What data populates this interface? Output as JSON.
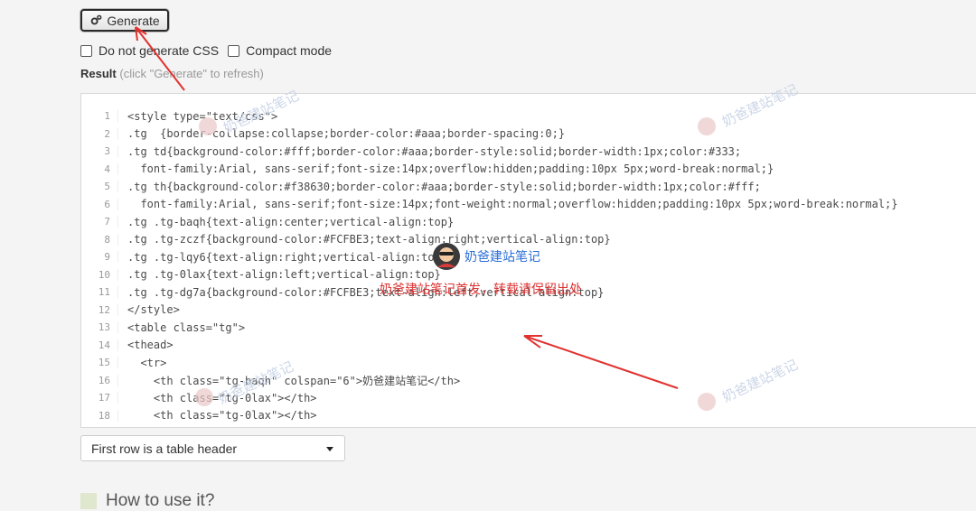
{
  "toolbar": {
    "generate_label": "Generate"
  },
  "options": [
    {
      "label": "Do not generate CSS",
      "checked": false
    },
    {
      "label": "Compact mode",
      "checked": false
    }
  ],
  "result": {
    "title": "Result",
    "hint": "(click \"Generate\" to refresh)"
  },
  "code_lines": [
    "<style type=\"text/css\">",
    ".tg  {border-collapse:collapse;border-color:#aaa;border-spacing:0;}",
    ".tg td{background-color:#fff;border-color:#aaa;border-style:solid;border-width:1px;color:#333;",
    "  font-family:Arial, sans-serif;font-size:14px;overflow:hidden;padding:10px 5px;word-break:normal;}",
    ".tg th{background-color:#f38630;border-color:#aaa;border-style:solid;border-width:1px;color:#fff;",
    "  font-family:Arial, sans-serif;font-size:14px;font-weight:normal;overflow:hidden;padding:10px 5px;word-break:normal;}",
    ".tg .tg-baqh{text-align:center;vertical-align:top}",
    ".tg .tg-zczf{background-color:#FCFBE3;text-align:right;vertical-align:top}",
    ".tg .tg-lqy6{text-align:right;vertical-align:top}",
    ".tg .tg-0lax{text-align:left;vertical-align:top}",
    ".tg .tg-dg7a{background-color:#FCFBE3;text-align:left;vertical-align:top}",
    "</style>",
    "<table class=\"tg\">",
    "<thead>",
    "  <tr>",
    "    <th class=\"tg-baqh\" colspan=\"6\">奶爸建站笔记</th>",
    "    <th class=\"tg-0lax\"></th>",
    "    <th class=\"tg-0lax\"></th>"
  ],
  "header_row_select": {
    "selected": "First row is a table header"
  },
  "section": {
    "title": "How to use it?"
  },
  "watermark": {
    "text": "奶爸建站笔记",
    "notice": "奶爸建站笔记首发，转载请保留出处"
  },
  "colors": {
    "accent_arrow": "#e0322f",
    "watermark_blue": "#2a6ed6"
  }
}
